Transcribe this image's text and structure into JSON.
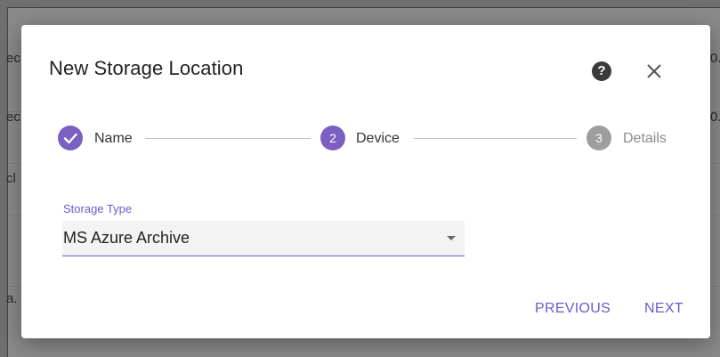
{
  "background": {
    "rows": [
      {
        "left_text": "ec",
        "right_text": "0."
      },
      {
        "left_text": "ec",
        "right_text": "0."
      },
      {
        "left_text": "cl",
        "right_text": ""
      },
      {
        "left_text": "",
        "right_text": ""
      },
      {
        "left_text": "a.",
        "right_text": ""
      }
    ]
  },
  "dialog": {
    "title": "New Storage Location",
    "help_icon": "help-icon",
    "help_glyph": "?",
    "close_icon": "close-icon"
  },
  "stepper": {
    "steps": [
      {
        "index": "1",
        "label": "Name",
        "state": "completed",
        "icon": "check-icon"
      },
      {
        "index": "2",
        "label": "Device",
        "state": "active"
      },
      {
        "index": "3",
        "label": "Details",
        "state": "inactive"
      }
    ]
  },
  "form": {
    "storage_type_label": "Storage Type",
    "storage_type_value": "MS Azure Archive"
  },
  "actions": {
    "previous_label": "PREVIOUS",
    "next_label": "NEXT"
  },
  "colors": {
    "accent": "#6a5acd",
    "step_active": "#7b5fc2",
    "step_inactive": "#9e9e9e",
    "backdrop": "#8a8a8a"
  }
}
